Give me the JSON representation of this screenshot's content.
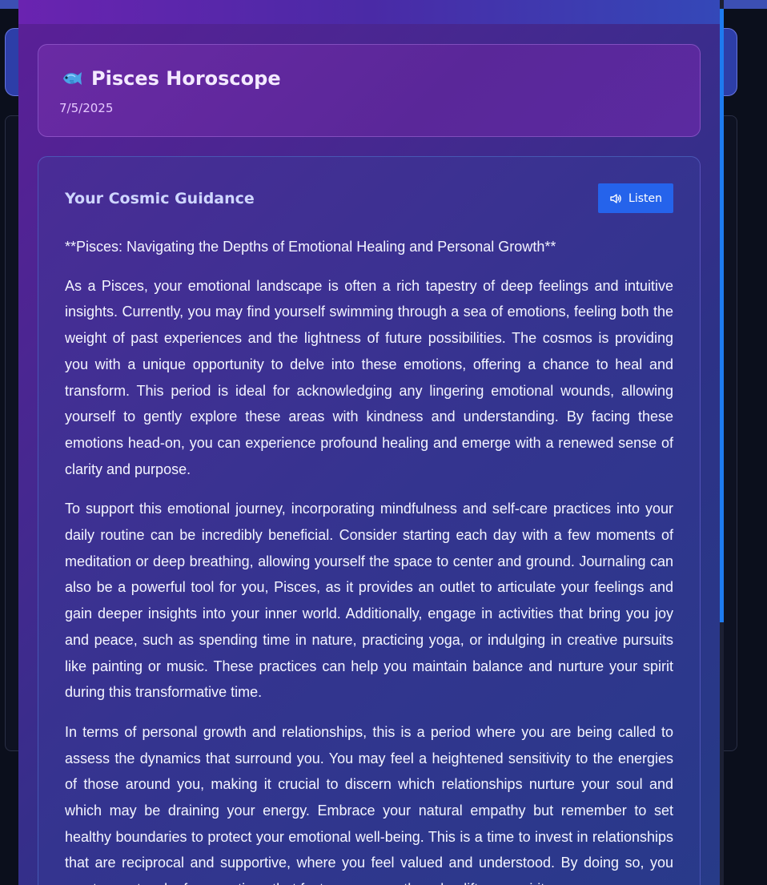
{
  "header": {
    "icon": "fish-icon",
    "title": "Pisces Horoscope",
    "date": "7/5/2025"
  },
  "guidance": {
    "title": "Your Cosmic Guidance",
    "listen_label": "Listen",
    "listen_icon": "speaker-icon",
    "paragraphs": [
      "**Pisces: Navigating the Depths of Emotional Healing and Personal Growth**",
      "As a Pisces, your emotional landscape is often a rich tapestry of deep feelings and intuitive insights. Currently, you may find yourself swimming through a sea of emotions, feeling both the weight of past experiences and the lightness of future possibilities. The cosmos is providing you with a unique opportunity to delve into these emotions, offering a chance to heal and transform. This period is ideal for acknowledging any lingering emotional wounds, allowing yourself to gently explore these areas with kindness and understanding. By facing these emotions head-on, you can experience profound healing and emerge with a renewed sense of clarity and purpose.",
      "To support this emotional journey, incorporating mindfulness and self-care practices into your daily routine can be incredibly beneficial. Consider starting each day with a few moments of meditation or deep breathing, allowing yourself the space to center and ground. Journaling can also be a powerful tool for you, Pisces, as it provides an outlet to articulate your feelings and gain deeper insights into your inner world. Additionally, engage in activities that bring you joy and peace, such as spending time in nature, practicing yoga, or indulging in creative pursuits like painting or music. These practices can help you maintain balance and nurture your spirit during this transformative time.",
      "In terms of personal growth and relationships, this is a period where you are being called to assess the dynamics that surround you. You may feel a heightened sensitivity to the energies of those around you, making it crucial to discern which relationships nurture your soul and which may be draining your energy. Embrace your natural empathy but remember to set healthy boundaries to protect your emotional well-being. This is a time to invest in relationships that are reciprocal and supportive, where you feel valued and understood. By doing so, you create a network of connections that foster your growth and uplift your spirit."
    ]
  },
  "colors": {
    "accent_button": "#2563eb",
    "scrollbar": "#1e7bf0"
  }
}
